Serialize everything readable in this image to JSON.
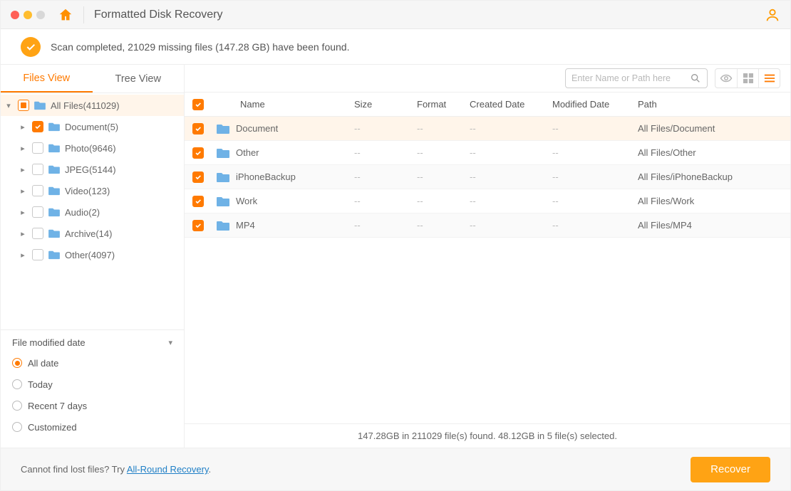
{
  "titlebar": {
    "title": "Formatted Disk Recovery"
  },
  "banner": {
    "text": "Scan completed, 21029 missing files (147.28 GB) have been found."
  },
  "sidebar": {
    "tabs": {
      "files_view": "Files View",
      "tree_view": "Tree View"
    },
    "root": {
      "label": "All Files(411029)"
    },
    "items": [
      {
        "label": "Document(5)",
        "checked": true
      },
      {
        "label": "Photo(9646)",
        "checked": false
      },
      {
        "label": "JPEG(5144)",
        "checked": false
      },
      {
        "label": "Video(123)",
        "checked": false
      },
      {
        "label": "Audio(2)",
        "checked": false
      },
      {
        "label": "Archive(14)",
        "checked": false
      },
      {
        "label": "Other(4097)",
        "checked": false
      }
    ]
  },
  "filter": {
    "title": "File modified date",
    "options": {
      "all": "All date",
      "today": "Today",
      "recent7": "Recent 7 days",
      "custom": "Customized"
    }
  },
  "search": {
    "placeholder": "Enter Name or Path here"
  },
  "table": {
    "headers": {
      "name": "Name",
      "size": "Size",
      "format": "Format",
      "created": "Created Date",
      "modified": "Modified Date",
      "path": "Path"
    },
    "rows": [
      {
        "name": "Document",
        "size": "--",
        "format": "--",
        "created": "--",
        "modified": "--",
        "path": "All Files/Document"
      },
      {
        "name": "Other",
        "size": "--",
        "format": "--",
        "created": "--",
        "modified": "--",
        "path": "All Files/Other"
      },
      {
        "name": "iPhoneBackup",
        "size": "--",
        "format": "--",
        "created": "--",
        "modified": "--",
        "path": "All Files/iPhoneBackup"
      },
      {
        "name": "Work",
        "size": "--",
        "format": "--",
        "created": "--",
        "modified": "--",
        "path": "All Files/Work"
      },
      {
        "name": "MP4",
        "size": "--",
        "format": "--",
        "created": "--",
        "modified": "--",
        "path": "All Files/MP4"
      }
    ]
  },
  "status": {
    "text": "147.28GB in 211029 file(s) found.  48.12GB in 5 file(s) selected."
  },
  "footer": {
    "hint_prefix": "Cannot find lost files? Try ",
    "link": "All-Round Recovery",
    "hint_suffix": ".",
    "recover": "Recover"
  }
}
